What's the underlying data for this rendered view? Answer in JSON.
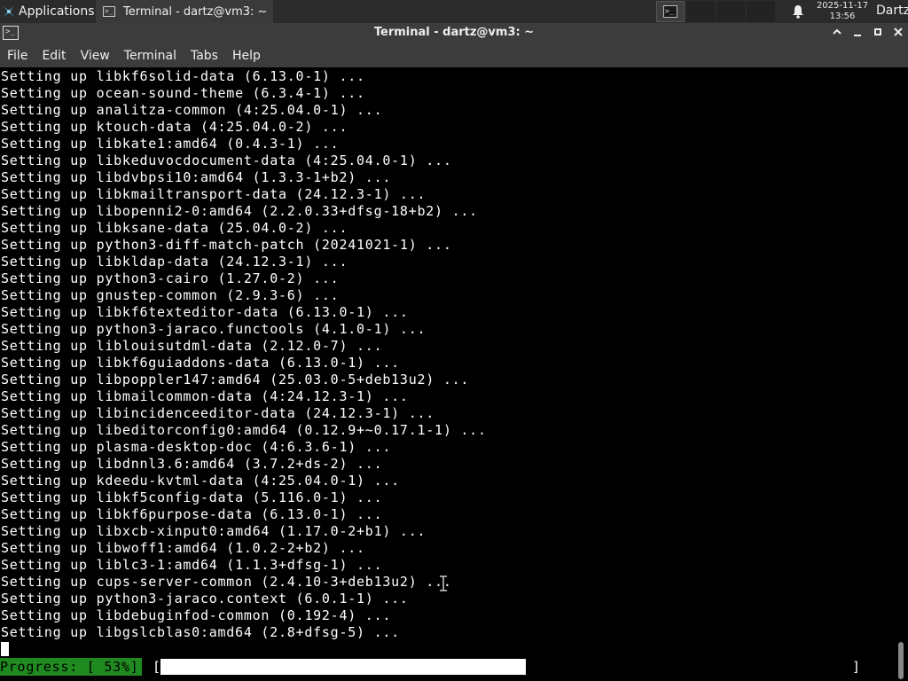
{
  "panel": {
    "applications_label": "Applications",
    "task_label": "Terminal - dartz@vm3: ~",
    "clock_date": "2025-11-17",
    "clock_time": "13:56",
    "user": "Dartz",
    "icons": [
      "applications-icon",
      "terminal-icon",
      "bell-icon"
    ]
  },
  "window": {
    "title": "Terminal - dartz@vm3: ~",
    "menu": [
      "File",
      "Edit",
      "View",
      "Terminal",
      "Tabs",
      "Help"
    ]
  },
  "terminal": {
    "lines": [
      "Setting up libkf6solid-data (6.13.0-1) ...",
      "Setting up ocean-sound-theme (6.3.4-1) ...",
      "Setting up analitza-common (4:25.04.0-1) ...",
      "Setting up ktouch-data (4:25.04.0-2) ...",
      "Setting up libkate1:amd64 (0.4.3-1) ...",
      "Setting up libkeduvocdocument-data (4:25.04.0-1) ...",
      "Setting up libdvbpsi10:amd64 (1.3.3-1+b2) ...",
      "Setting up libkmailtransport-data (24.12.3-1) ...",
      "Setting up libopenni2-0:amd64 (2.2.0.33+dfsg-18+b2) ...",
      "Setting up libksane-data (25.04.0-2) ...",
      "Setting up python3-diff-match-patch (20241021-1) ...",
      "Setting up libkldap-data (24.12.3-1) ...",
      "Setting up python3-cairo (1.27.0-2) ...",
      "Setting up gnustep-common (2.9.3-6) ...",
      "Setting up libkf6texteditor-data (6.13.0-1) ...",
      "Setting up python3-jaraco.functools (4.1.0-1) ...",
      "Setting up liblouisutdml-data (2.12.0-7) ...",
      "Setting up libkf6guiaddons-data (6.13.0-1) ...",
      "Setting up libpoppler147:amd64 (25.03.0-5+deb13u2) ...",
      "Setting up libmailcommon-data (4:24.12.3-1) ...",
      "Setting up libincidenceeditor-data (24.12.3-1) ...",
      "Setting up libeditorconfig0:amd64 (0.12.9+~0.17.1-1) ...",
      "Setting up plasma-desktop-doc (4:6.3.6-1) ...",
      "Setting up libdnnl3.6:amd64 (3.7.2+ds-2) ...",
      "Setting up kdeedu-kvtml-data (4:25.04.0-1) ...",
      "Setting up libkf5config-data (5.116.0-1) ...",
      "Setting up libkf6purpose-data (6.13.0-1) ...",
      "Setting up libxcb-xinput0:amd64 (1.17.0-2+b1) ...",
      "Setting up libwoff1:amd64 (1.0.2-2+b2) ...",
      "Setting up liblc3-1:amd64 (1.1.3+dfsg-1) ...",
      "Setting up cups-server-common (2.4.10-3+deb13u2) ...",
      "Setting up python3-jaraco.context (6.0.1-1) ...",
      "Setting up libdebuginfod-common (0.192-4) ...",
      "Setting up libgslcblas0:amd64 (2.8+dfsg-5) ..."
    ],
    "progress_label": "Progress: [ 53%]",
    "progress_open": "[",
    "progress_close": "]",
    "progress_fraction": 0.53
  },
  "colors": {
    "progress_label_bg": "#1f8a1f",
    "terminal_bg": "#000000",
    "chrome_bg": "#3c3c3c"
  }
}
